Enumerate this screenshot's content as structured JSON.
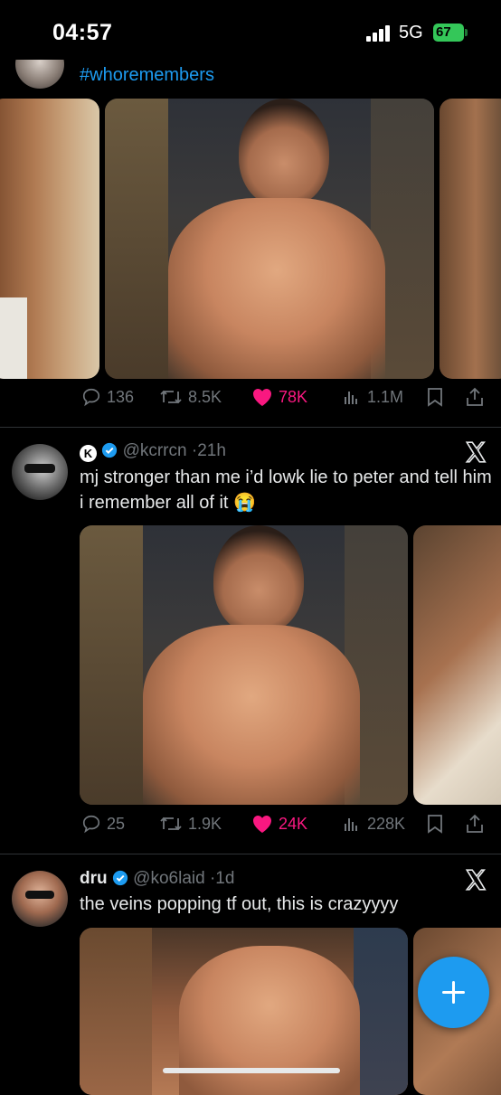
{
  "status_bar": {
    "time": "04:57",
    "network": "5G",
    "battery": "67"
  },
  "tweets": [
    {
      "hashtag": "#whoremembers",
      "stats": {
        "replies": "136",
        "reposts": "8.5K",
        "likes": "78K",
        "views": "1.1M"
      }
    },
    {
      "handle": "@kcrrcn",
      "time": "21h",
      "text": "mj stronger than me i’d lowk lie to peter and tell him i remember all of it 😭",
      "stats": {
        "replies": "25",
        "reposts": "1.9K",
        "likes": "24K",
        "views": "228K"
      }
    },
    {
      "name": "dru",
      "handle": "@ko6laid",
      "time": "1d",
      "text": "the veins popping tf out, this is crazyyyy"
    }
  ],
  "colors": {
    "accent": "#1d9bf0",
    "like": "#f91880",
    "muted": "#71767b",
    "battery": "#34c759"
  }
}
